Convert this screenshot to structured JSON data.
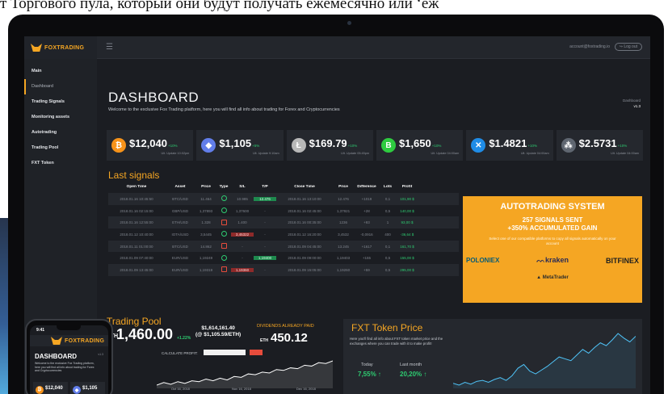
{
  "caption": "т Торгового пула, который они будут получать ежемесячно или ‘еж",
  "colors": {
    "accent": "#f5a623",
    "positive": "#2ecc71",
    "negative": "#e74c3c",
    "background": "#1b1d22"
  },
  "topbar": {
    "logo": "FOXTRADING",
    "account": "account@foxtrading.io",
    "logout": "↪ Log out"
  },
  "sidebar": {
    "items": [
      {
        "label": "Main",
        "type": "header"
      },
      {
        "label": "Dashboard",
        "type": "active"
      },
      {
        "label": "Trading Signals",
        "type": "header"
      },
      {
        "label": "Monitoring assets",
        "type": "header"
      },
      {
        "label": "Autotrading",
        "type": "header"
      },
      {
        "label": "Trading Pool",
        "type": "header"
      },
      {
        "label": "FXT Token",
        "type": "header"
      }
    ]
  },
  "header": {
    "title": "DASHBOARD",
    "subtitle": "Welcome to the exclusive Fox Trading platform, here you will find all info about trading for Forex and Cryptocurrencies",
    "crumb_1": "Dashboard",
    "crumb_2": "v1.3"
  },
  "tickers": [
    {
      "icon": "bitcoin-icon",
      "glyph": "₿",
      "color": "#f7931a",
      "price": "$12,040",
      "change": "+10%",
      "updated": "Ult. Update 10:02pm"
    },
    {
      "icon": "ethereum-icon",
      "glyph": "◆",
      "color": "#627eea",
      "price": "$1,105",
      "change": "+5%",
      "updated": "Ult. Update 9:10am"
    },
    {
      "icon": "litecoin-icon",
      "glyph": "Ł",
      "color": "#b8b8b8",
      "price": "$169.79",
      "change": "+10%",
      "updated": "Ult. Update 05:45pm"
    },
    {
      "icon": "bitcoin-cash-icon",
      "glyph": "B",
      "color": "#2ecc40",
      "price": "$1,650",
      "change": "+10%",
      "updated": "Ult. Update 04:00am"
    },
    {
      "icon": "ripple-icon",
      "glyph": "✕",
      "color": "#1f8ce6",
      "price": "$1.4821",
      "change": "+10%",
      "updated": "Ult. Update 04:00am"
    },
    {
      "icon": "iota-icon",
      "glyph": "⁂",
      "color": "#5f6670",
      "price": "$2.5731",
      "change": "+10%",
      "updated": "Ult. Update 04:00am"
    }
  ],
  "signals": {
    "title": "Last signals",
    "columns": [
      "Open Time",
      "Asset",
      "Price",
      "Type",
      "S/L",
      "T/P",
      "Close Time",
      "Price",
      "Difference",
      "Lots",
      "Profit"
    ],
    "rows": [
      {
        "open": "2018.01.16 10:45:50",
        "asset": "BTC/USD",
        "price": "11.464",
        "type": "buy",
        "sl": "10.985",
        "tp": "12.476",
        "close": "2018.01.16 13:10:00",
        "cprice": "12.476",
        "diff": "+1019",
        "lots": "0,1",
        "profit": "101,90 $",
        "hit": "tp"
      },
      {
        "open": "2018.01.16 02:15:00",
        "asset": "GBP/USD",
        "price": "1,37893",
        "type": "buy",
        "sl": "1,37600",
        "tp": "-",
        "close": "2018.01.16 02:45:00",
        "cprice": "1,37921",
        "diff": "+28",
        "lots": "0,5",
        "profit": "140,00 $",
        "hit": ""
      },
      {
        "open": "2018.01.16 12:55:00",
        "asset": "ETH/USD",
        "price": "1.328",
        "type": "sell",
        "sl": "1.400",
        "tp": "-",
        "close": "2018.01.16 00:35:00",
        "cprice": "1236",
        "diff": "+93",
        "lots": "1",
        "profit": "93,00 $",
        "hit": ""
      },
      {
        "open": "2018.01.12 10:40:00",
        "asset": "IOTA/USD",
        "price": "3,5445",
        "type": "buy",
        "sl": "3,45322",
        "tp": "-",
        "close": "2018.01.12 16:20:00",
        "cprice": "3,4532",
        "diff": "-0,0916",
        "lots": "400",
        "profit": "-36,64 $",
        "hit": "sl"
      },
      {
        "open": "2018.01.11 01:00:00",
        "asset": "BTC/USD",
        "price": "14.862",
        "type": "sell",
        "sl": "-",
        "tp": "-",
        "close": "2018.01.09 04:45:00",
        "cprice": "13.245",
        "diff": "+1617",
        "lots": "0,1",
        "profit": "161,70 $",
        "hit": ""
      },
      {
        "open": "2018.01.09 07:40:00",
        "asset": "EUR/USD",
        "price": "1,19249",
        "type": "buy",
        "sl": "-",
        "tp": "1,19400",
        "close": "2018.01.09 09:00:00",
        "cprice": "1,19403",
        "diff": "+155",
        "lots": "0,5",
        "profit": "155,00 $",
        "hit": "tp"
      },
      {
        "open": "2018.01.09 13:45:00",
        "asset": "EUR/USD",
        "price": "1,19319",
        "type": "sell",
        "sl": "1,19360",
        "tp": "-",
        "close": "2018.01.09 15:05:00",
        "cprice": "1,19260",
        "diff": "+59",
        "lots": "0,5",
        "profit": "295,00 $",
        "hit": "sl"
      }
    ]
  },
  "autotrading": {
    "title": "AUTOTRADING SYSTEM",
    "line2": "257 SIGNALS SENT",
    "line3": "+350% ACCUMULATED GAIN",
    "line4": "Select one of our compatible platforms to copy all signals automatically on your account",
    "brand1": "POLONIEX",
    "brand2": "kraken",
    "brand3": "BITFINEX",
    "brand4": "MetaTrader"
  },
  "pool": {
    "title": "Trading Pool",
    "eth_label": "ETH",
    "eth_value": "1,460.00",
    "eth_change": "+1.22%",
    "usd_value": "$1,614,161.40",
    "usd_rate": "(@ $1,105.59/ETH)",
    "dividends_label": "DIVIDENDS ALREADY PAID",
    "dividends_unit": "ETH",
    "dividends_value": "450.12",
    "calc_label": "CALCULATE PROFIT:",
    "calc_placeholder": "",
    "dates": [
      "Oct 16, 2018",
      "Nov 16, 2018",
      "Dec 16, 2018"
    ],
    "series": [
      20,
      23,
      21,
      24,
      22,
      25,
      24,
      27,
      25,
      28,
      26,
      30,
      29,
      33,
      32,
      35,
      34,
      38,
      37,
      40,
      39,
      43,
      42,
      46,
      45,
      48
    ]
  },
  "fxt": {
    "title": "FXT Token Price",
    "desc": "Here you'll find all info about FXT token market price and the exchanges where you can trade with it to make profit!",
    "today_label": "Today",
    "today_value": "7,55% ↑",
    "month_label": "Last month",
    "month_value": "20,20% ↑",
    "series": [
      42,
      40,
      43,
      41,
      44,
      45,
      43,
      46,
      48,
      45,
      50,
      58,
      62,
      55,
      52,
      56,
      60,
      65,
      70,
      68,
      66,
      72,
      78,
      74,
      80,
      85,
      82,
      88,
      95,
      90,
      86,
      92
    ]
  },
  "phone": {
    "time": "9:41",
    "logo": "FOXTRADING",
    "title": "DASHBOARD",
    "crumb": "v1.3",
    "subtitle": "Welcome to the exclusive Fox Trading platform, here you will find all info about trading for Forex and Cryptocurrencies",
    "t1_price": "$12,040",
    "t2_price": "$1,105"
  }
}
